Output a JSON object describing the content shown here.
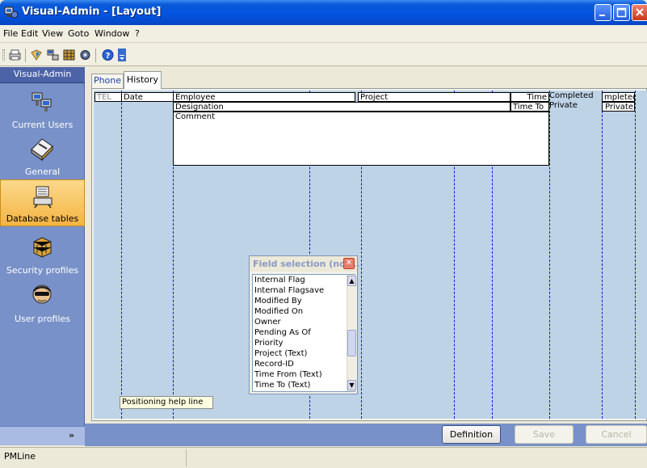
{
  "window": {
    "title": "Visual-Admin - [Layout]"
  },
  "menu": [
    "File",
    "Edit",
    "View",
    "Goto",
    "Window",
    "?"
  ],
  "toolbar": {
    "icons": [
      "print-icon",
      "shield-icon",
      "network-icon",
      "database-icon",
      "settings-icon",
      "help-icon",
      "dropdown-icon"
    ]
  },
  "sidebar": {
    "header": "Visual-Admin",
    "items": [
      {
        "label": "Current Users",
        "icon": "current-users-icon"
      },
      {
        "label": "General",
        "icon": "general-icon"
      },
      {
        "label": "Database tables",
        "icon": "database-tables-icon",
        "selected": true
      },
      {
        "label": "Security profiles",
        "icon": "security-profiles-icon"
      },
      {
        "label": "User profiles",
        "icon": "user-profiles-icon"
      }
    ]
  },
  "tabs": [
    {
      "label": "Phone",
      "active": false
    },
    {
      "label": "History",
      "active": true
    }
  ],
  "layout_fields": {
    "tel": "TEL",
    "date": "Date",
    "employee": "Employee",
    "project": "Project",
    "time": "Time",
    "completed": "Completed",
    "completed_narrow": "mpleted",
    "designation": "Designation",
    "time_to": "Time To",
    "private": "Private",
    "private_narrow": "Private",
    "comment": "Comment"
  },
  "field_selection": {
    "title": "Field selection (not...",
    "items": [
      "Internal Flag",
      "Internal Flagsave",
      "Modified By",
      "Modified On",
      "Owner",
      "Pending As Of",
      "Priority",
      "Project (Text)",
      "Record-ID",
      "Time From (Text)",
      "Time To (Text)"
    ]
  },
  "help_line": "Positioning help line",
  "buttons": {
    "definition": "Definition",
    "save": "Save",
    "cancel": "Cancel"
  },
  "status": {
    "text": "PMLine"
  },
  "colors": {
    "titlebar": "#0454e0",
    "sidebar": "#7891c8",
    "selected_item": "#f5b444",
    "canvas": "#bed3e6",
    "guide_lines": "#1010d8"
  }
}
